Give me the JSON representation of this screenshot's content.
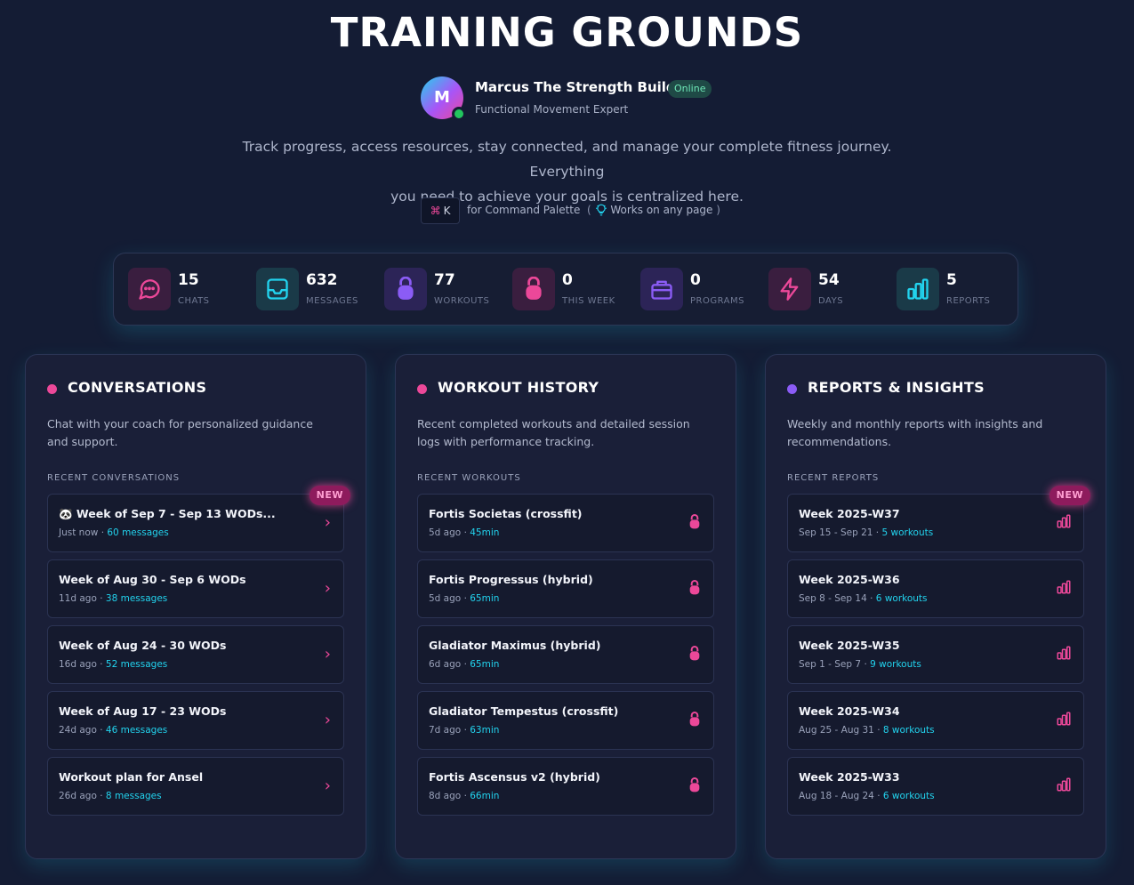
{
  "header": {
    "title": "TRAINING GROUNDS",
    "coach": {
      "avatar_initial": "M",
      "name": "Marcus The Strength Builder",
      "status": "Online",
      "role": "Functional Movement Expert"
    },
    "intro_line1": "Track progress, access resources, stay connected, and manage your complete fitness journey. Everything",
    "intro_line2": "you need to achieve your goals is centralized here.",
    "command": {
      "shortcut_symbol": "⌘",
      "shortcut_key": "K",
      "text": "for Command Palette",
      "paren_open": "(",
      "hint": "Works on any page",
      "paren_close": ")"
    }
  },
  "stats": [
    {
      "value": "15",
      "label": "CHATS",
      "icon": "chat-icon",
      "color": "#ec4899"
    },
    {
      "value": "632",
      "label": "MESSAGES",
      "icon": "inbox-icon",
      "color": "#22d3ee"
    },
    {
      "value": "77",
      "label": "WORKOUTS",
      "icon": "kettlebell-icon",
      "color": "#8b5cf6"
    },
    {
      "value": "0",
      "label": "THIS WEEK",
      "icon": "kettlebell-icon",
      "color": "#ec4899"
    },
    {
      "value": "0",
      "label": "PROGRAMS",
      "icon": "briefcase-icon",
      "color": "#8b5cf6"
    },
    {
      "value": "54",
      "label": "DAYS",
      "icon": "lightning-icon",
      "color": "#ec4899"
    },
    {
      "value": "5",
      "label": "REPORTS",
      "icon": "bar-chart-icon",
      "color": "#22d3ee"
    }
  ],
  "panels": {
    "conversations": {
      "title": "CONVERSATIONS",
      "dot_color": "#ec4899",
      "description": "Chat with your coach for personalized guidance and support.",
      "section_label": "RECENT CONVERSATIONS",
      "new_badge": "NEW",
      "items": [
        {
          "title": "🐼 Week of Sep 7 - Sep 13 WODs...",
          "time": "Just now",
          "count": "60 messages"
        },
        {
          "title": "Week of Aug 30 - Sep 6 WODs",
          "time": "11d ago",
          "count": "38 messages"
        },
        {
          "title": "Week of Aug 24 - 30 WODs",
          "time": "16d ago",
          "count": "52 messages"
        },
        {
          "title": "Week of Aug 17 - 23 WODs",
          "time": "24d ago",
          "count": "46 messages"
        },
        {
          "title": "Workout plan for Ansel",
          "time": "26d ago",
          "count": "8 messages"
        }
      ]
    },
    "workouts": {
      "title": "WORKOUT HISTORY",
      "dot_color": "#ec4899",
      "description": "Recent completed workouts and detailed session logs with performance tracking.",
      "section_label": "RECENT WORKOUTS",
      "items": [
        {
          "title": "Fortis Societas (crossfit)",
          "time": "5d ago",
          "duration": "45min"
        },
        {
          "title": "Fortis Progressus (hybrid)",
          "time": "5d ago",
          "duration": "65min"
        },
        {
          "title": "Gladiator Maximus (hybrid)",
          "time": "6d ago",
          "duration": "65min"
        },
        {
          "title": "Gladiator Tempestus (crossfit)",
          "time": "7d ago",
          "duration": "63min"
        },
        {
          "title": "Fortis Ascensus v2 (hybrid)",
          "time": "8d ago",
          "duration": "66min"
        }
      ]
    },
    "reports": {
      "title": "REPORTS & INSIGHTS",
      "dot_color": "#8b5cf6",
      "description": "Weekly and monthly reports with insights and recommendations.",
      "section_label": "RECENT REPORTS",
      "new_badge": "NEW",
      "items": [
        {
          "title": "Week 2025-W37",
          "range": "Sep 15 - Sep 21",
          "count": "5 workouts"
        },
        {
          "title": "Week 2025-W36",
          "range": "Sep 8 - Sep 14",
          "count": "6 workouts"
        },
        {
          "title": "Week 2025-W35",
          "range": "Sep 1 - Sep 7",
          "count": "9 workouts"
        },
        {
          "title": "Week 2025-W34",
          "range": "Aug 25 - Aug 31",
          "count": "8 workouts"
        },
        {
          "title": "Week 2025-W33",
          "range": "Aug 18 - Aug 24",
          "count": "6 workouts"
        }
      ]
    }
  },
  "meta_separator": "·"
}
